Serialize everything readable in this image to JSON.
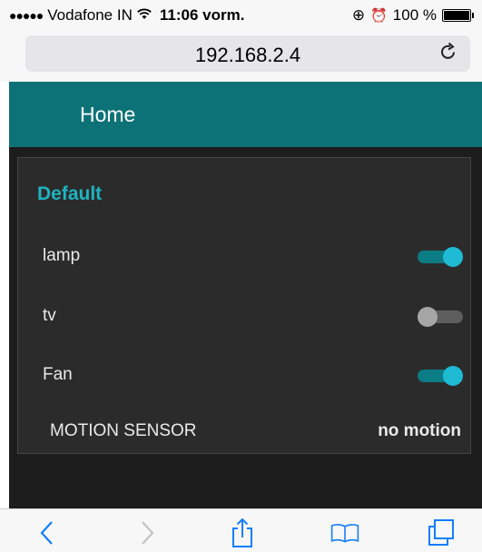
{
  "status_bar": {
    "signal": "●●●●●",
    "carrier": "Vodafone IN",
    "wifi_icon": "wifi-icon",
    "time": "11:06 vorm.",
    "lock_icon": "⊕",
    "alarm_icon": "⏰",
    "battery": "100 %"
  },
  "browser": {
    "url": "192.168.2.4",
    "reload_icon": "reload-icon"
  },
  "header": {
    "title": "Home"
  },
  "panel": {
    "title": "Default",
    "devices": [
      {
        "label": "lamp",
        "state": "on"
      },
      {
        "label": "tv",
        "state": "off"
      },
      {
        "label": "Fan",
        "state": "on"
      }
    ],
    "sensor": {
      "label": "MOTION SENSOR",
      "value": "no motion"
    }
  },
  "toolbar": {
    "icons": [
      "back-icon",
      "forward-icon",
      "share-icon",
      "bookmarks-icon",
      "tabs-icon"
    ]
  },
  "colors": {
    "header": "#0d7277",
    "accent": "#1eb4c0",
    "panel": "#2b2b2b",
    "background": "#1d1d1d",
    "ios_blue": "#147efb"
  }
}
